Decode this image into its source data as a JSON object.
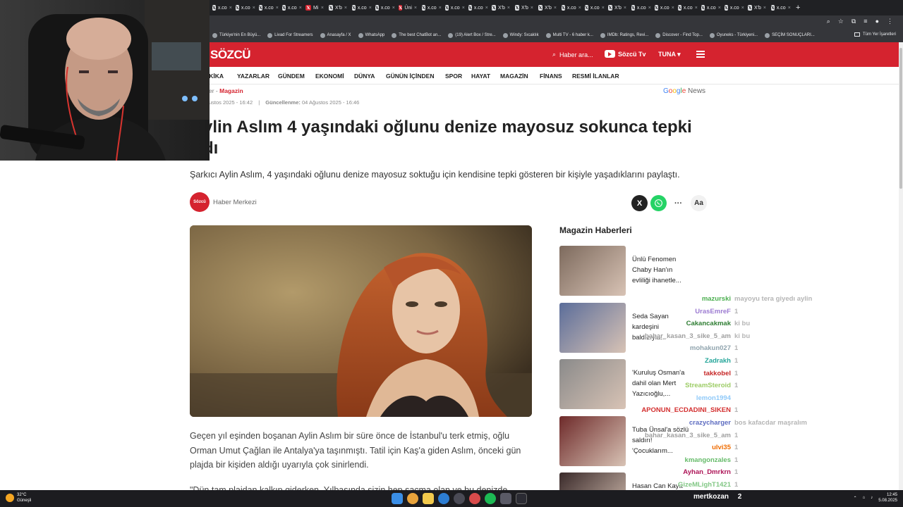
{
  "browser": {
    "tabs": [
      {
        "label": "x.co"
      },
      {
        "label": "x.co"
      },
      {
        "label": "x.co"
      },
      {
        "label": "x.co"
      },
      {
        "label": "Mi"
      },
      {
        "label": "X'b"
      },
      {
        "label": "x.co"
      },
      {
        "label": "x.co"
      },
      {
        "label": "Üni"
      },
      {
        "label": "x.co"
      },
      {
        "label": "x.co"
      },
      {
        "label": "x.co"
      },
      {
        "label": "X'b"
      },
      {
        "label": "X'b"
      },
      {
        "label": "X'b"
      },
      {
        "label": "x.co"
      },
      {
        "label": "x.co"
      },
      {
        "label": "X'b"
      },
      {
        "label": "x.co"
      },
      {
        "label": "x.co"
      },
      {
        "label": "x.co"
      },
      {
        "label": "x.co"
      },
      {
        "label": "x.co"
      },
      {
        "label": "X'b"
      },
      {
        "label": "x.co"
      }
    ],
    "new_tab": "+",
    "bookmarks": [
      "Türkiye'nin En Büyü...",
      "Livad For Streamers",
      "Anasayfa / X",
      "WhatsApp",
      "The best ChatBot an...",
      "(19) Alert Box / Stre...",
      "Windy: Sıcaklık",
      "Multi TV - 6 haber k...",
      "IMDb: Ratings, Revi...",
      "Discover - Find Top...",
      "Oyuneks - Türkiyeni...",
      "SEÇİM SONUÇLARI..."
    ],
    "all_bookmarks": "Tüm Yer İşaretleri"
  },
  "site": {
    "logo": "SÖZCÜ",
    "search_placeholder": "Haber ara...",
    "tv": "Sözcü Tv",
    "user": "TUNA",
    "nav": [
      "DAKİKA",
      "YAZARLAR",
      "GÜNDEM",
      "EKONOMİ",
      "DÜNYA",
      "GÜNÜN İÇİNDEN",
      "SPOR",
      "HAYAT",
      "MAGAZİN",
      "FİNANS",
      "RESMİ İLANLAR"
    ]
  },
  "article": {
    "crumb_prefix": "er - ",
    "crumb_category": "Magazin",
    "google_news": "Google News",
    "published": "ustos 2025 - 16:42",
    "updated_label": "Güncellenme:",
    "updated": "04 Ağustos 2025 - 16:46",
    "title_line1": "ylin Aslım 4 yaşındaki oğlunu denize mayosuz sokunca tepki",
    "title_line2": "dı",
    "spot": "Şarkıcı Aylin Aslım, 4 yaşındaki oğlunu denize mayosuz soktuğu için kendisine tepki gösteren bir kişiyle yaşadıklarını paylaştı.",
    "author_logo": "Sözcü",
    "author": "Haber Merkezi",
    "share_x": "X",
    "share_more": "···",
    "share_aa": "Aa",
    "paragraph1": "Geçen yıl eşinden boşanan Aylin Aslım bir süre önce de İstanbul'u terk etmiş, oğlu Orman Umut Çağlan  ile Antalya'ya taşınmıştı. Tatil için Kaş'a giden Aslım, önceki gün plajda bir kişiden aldığı uyarıyla çok sinirlendi.",
    "paragraph2": "\"Dün tam plajdan kalkıp giderken, Yılbaşında sizin hep saçma olan ve bu denizde"
  },
  "sidebar": {
    "title": "Magazin Haberleri",
    "items": [
      {
        "title": "Ünlü Fenomen Chaby Han'ın evliliği ihanetle...",
        "color": "#7d6a5d"
      },
      {
        "title": "Seda Sayan kardeşini baldızıyla...",
        "color": "#5b6d9a"
      },
      {
        "title": "'Kuruluş Osman'a dahil olan Mert Yazıcıoğlu,...",
        "color": "#8a8a8a"
      },
      {
        "title": "Tuba Ünsal'a sözlü saldırı! 'Çocuklarım...",
        "color": "#6e2a2a"
      },
      {
        "title": "Hasan Can Kaya",
        "color": "#3a2a2a"
      }
    ]
  },
  "chat": [
    {
      "user": "mazurski",
      "msg": "mayoyu tera giyedı aylin",
      "color": "#4caf50"
    },
    {
      "user": "UrasEmreF",
      "msg": "1",
      "color": "#9c7bd1"
    },
    {
      "user": "Cakancakmak",
      "msg": "ki bu",
      "color": "#2e7d32"
    },
    {
      "user": "bahar_kasan_3_sike_5_am",
      "msg": "ki bu",
      "color": "#9e9e9e"
    },
    {
      "user": "mohakun027",
      "msg": "1",
      "color": "#90a4ae"
    },
    {
      "user": "Zadrakh",
      "msg": "1",
      "color": "#26a69a"
    },
    {
      "user": "takkobel",
      "msg": "1",
      "color": "#c62828"
    },
    {
      "user": "StreamSteroid",
      "msg": "1",
      "color": "#9ccc65"
    },
    {
      "user": "lemon1994",
      "msg": "",
      "color": "#90caf9"
    },
    {
      "user": "APONUN_ECDADINI_SIKEN",
      "msg": "1",
      "color": "#d32f2f"
    },
    {
      "user": "crazycharger",
      "msg": "bos kafacdar maşralım",
      "color": "#5c6bc0"
    },
    {
      "user": "bahar_kasan_3_sike_5_am",
      "msg": "1",
      "color": "#9e9e9e"
    },
    {
      "user": "ulvi35",
      "msg": "1",
      "color": "#ef6c00"
    },
    {
      "user": "kmangonzales",
      "msg": "1",
      "color": "#66bb6a"
    },
    {
      "user": "Ayhan_Dmrkrn",
      "msg": "1",
      "color": "#ad1457"
    },
    {
      "user": "GizeMLighT1421",
      "msg": "1",
      "color": "#81c784"
    }
  ],
  "chat_bottom": {
    "user": "mertkozan",
    "msg": "2"
  },
  "taskbar": {
    "temp": "32°C",
    "weather": "Güneşli",
    "time": "12:45",
    "date": "5.08.2025"
  }
}
